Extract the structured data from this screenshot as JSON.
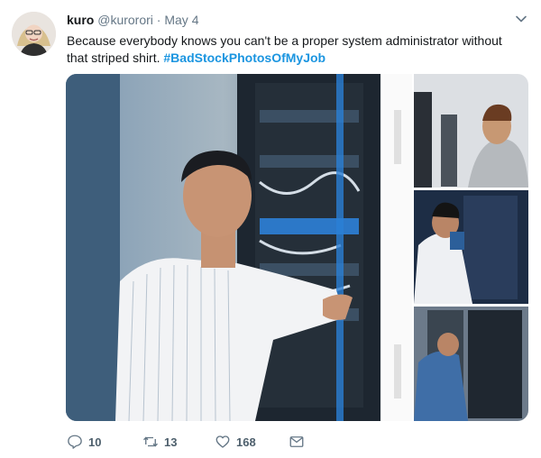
{
  "tweet": {
    "display_name": "kuro",
    "handle": "@kurorori",
    "separator": "·",
    "date": "May 4",
    "text": "Because everybody knows you can't be a proper system administrator without that striped shirt.",
    "hashtag": "#BadStockPhotosOfMyJob"
  },
  "actions": {
    "reply_count": "10",
    "retweet_count": "13",
    "like_count": "168"
  },
  "colors": {
    "accent": "#1b95e0",
    "text": "#14171a",
    "muted": "#657786"
  }
}
